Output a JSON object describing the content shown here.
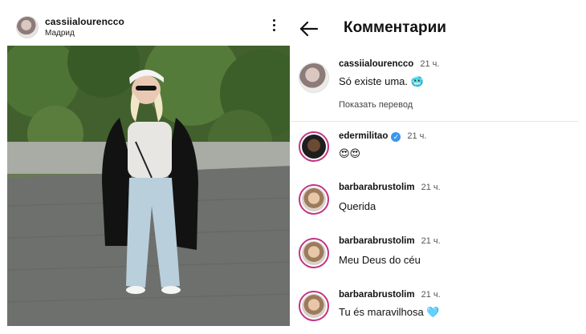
{
  "post": {
    "username": "cassiialourencco",
    "location": "Мадрид",
    "menu_icon": "more-vertical-icon"
  },
  "comments_panel": {
    "back_icon": "arrow-left-icon",
    "title": "Комментарии",
    "items": [
      {
        "username": "cassiialourencco",
        "time": "21 ч.",
        "text": "Só existe uma. 🥶",
        "translate": "Показать перевод",
        "verified": false
      },
      {
        "username": "edermilitao",
        "time": "21 ч.",
        "text": "😍😍",
        "verified": true
      },
      {
        "username": "barbarabrustolim",
        "time": "21 ч.",
        "text": "Querida",
        "verified": false
      },
      {
        "username": "barbarabrustolim",
        "time": "21 ч.",
        "text": "Meu Deus do céu",
        "verified": false
      },
      {
        "username": "barbarabrustolim",
        "time": "21 ч.",
        "text": "Tu és maravilhosa 🩵",
        "verified": false
      }
    ]
  },
  "colors": {
    "story_ring": "#c13584",
    "verified_badge": "#3897f0"
  }
}
